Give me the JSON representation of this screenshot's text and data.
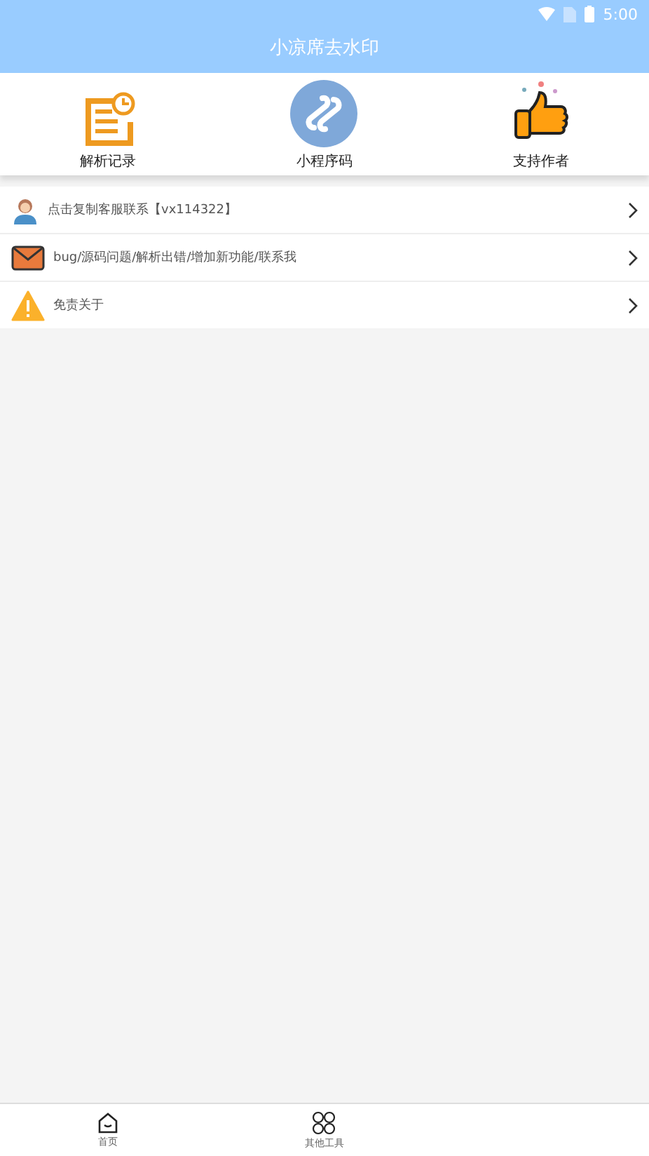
{
  "status_bar": {
    "time": "5:00"
  },
  "title": "小凉席去水印",
  "shortcuts": [
    {
      "kind": "record",
      "label": "解析记录"
    },
    {
      "kind": "miniapp",
      "label": "小程序码"
    },
    {
      "kind": "thumb",
      "label": "支持作者"
    }
  ],
  "menu": [
    {
      "kind": "service",
      "label": "点击复制客服联系【vx114322】"
    },
    {
      "kind": "mail",
      "label": "bug/源码问题/解析出错/增加新功能/联系我"
    },
    {
      "kind": "warning",
      "label": "免责关于"
    }
  ],
  "bottom_nav": [
    {
      "kind": "home",
      "label": "首页"
    },
    {
      "kind": "tools",
      "label": "其他工具"
    }
  ]
}
